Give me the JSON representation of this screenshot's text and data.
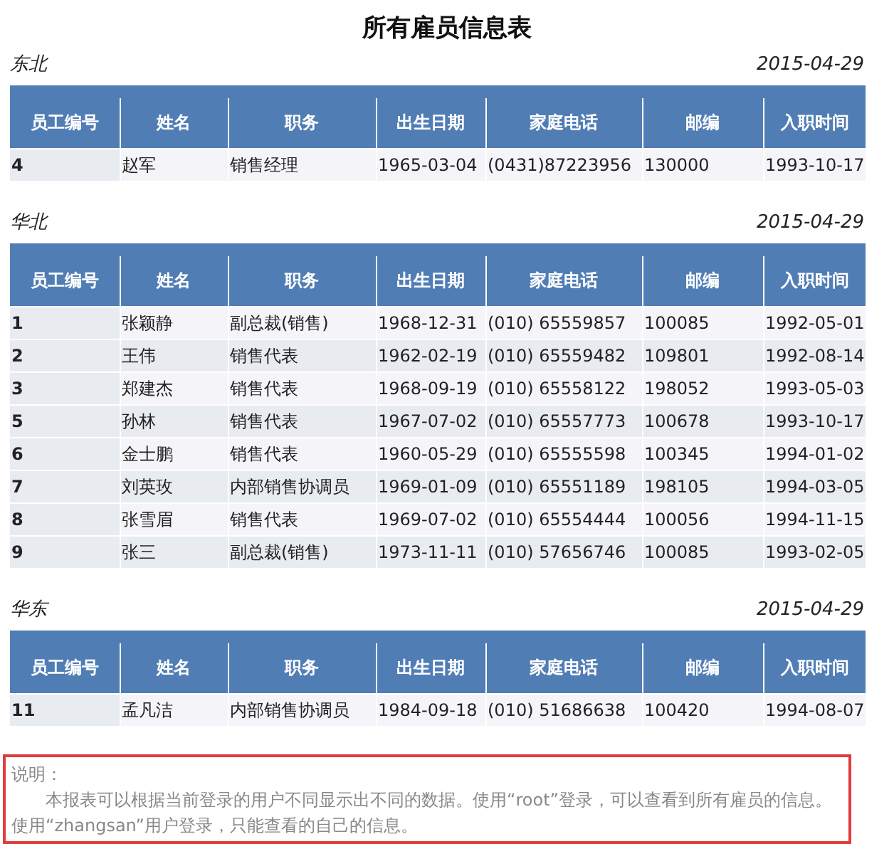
{
  "title": "所有雇员信息表",
  "groups": [
    {
      "region": "东北",
      "date": "2015-04-29",
      "columns": [
        "员工编号",
        "姓名",
        "职务",
        "出生日期",
        "家庭电话",
        "邮编",
        "入职时间"
      ],
      "rows": [
        [
          "4",
          "赵军",
          "销售经理",
          "1965-03-04",
          "(0431)87223956",
          "130000",
          "1993-10-17"
        ]
      ]
    },
    {
      "region": "华北",
      "date": "2015-04-29",
      "columns": [
        "员工编号",
        "姓名",
        "职务",
        "出生日期",
        "家庭电话",
        "邮编",
        "入职时间"
      ],
      "rows": [
        [
          "1",
          "张颖静",
          "副总裁(销售)",
          "1968-12-31",
          "(010) 65559857",
          "100085",
          "1992-05-01"
        ],
        [
          "2",
          "王伟",
          "销售代表",
          "1962-02-19",
          "(010) 65559482",
          "109801",
          "1992-08-14"
        ],
        [
          "3",
          "郑建杰",
          "销售代表",
          "1968-09-19",
          "(010) 65558122",
          "198052",
          "1993-05-03"
        ],
        [
          "5",
          "孙林",
          "销售代表",
          "1967-07-02",
          "(010) 65557773",
          "100678",
          "1993-10-17"
        ],
        [
          "6",
          "金士鹏",
          "销售代表",
          "1960-05-29",
          "(010) 65555598",
          "100345",
          "1994-01-02"
        ],
        [
          "7",
          "刘英玫",
          "内部销售协调员",
          "1969-01-09",
          "(010) 65551189",
          "198105",
          "1994-03-05"
        ],
        [
          "8",
          "张雪眉",
          "销售代表",
          "1969-07-02",
          "(010) 65554444",
          "100056",
          "1994-11-15"
        ],
        [
          "9",
          "张三",
          "副总裁(销售)",
          "1973-11-11",
          "(010) 57656746",
          "100085",
          "1993-02-05"
        ]
      ]
    },
    {
      "region": "华东",
      "date": "2015-04-29",
      "columns": [
        "员工编号",
        "姓名",
        "职务",
        "出生日期",
        "家庭电话",
        "邮编",
        "入职时间"
      ],
      "rows": [
        [
          "11",
          "孟凡洁",
          "内部销售协调员",
          "1984-09-18",
          "(010) 51686638",
          "100420",
          "1994-08-07"
        ]
      ]
    }
  ],
  "note": {
    "label": "说明：",
    "lines": [
      "本报表可以根据当前登录的用户不同显示出不同的数据。使用“root”登录，可以查看到所有雇员的信息。",
      "使用“zhangsan”用户登录，只能查看的自己的信息。"
    ]
  }
}
